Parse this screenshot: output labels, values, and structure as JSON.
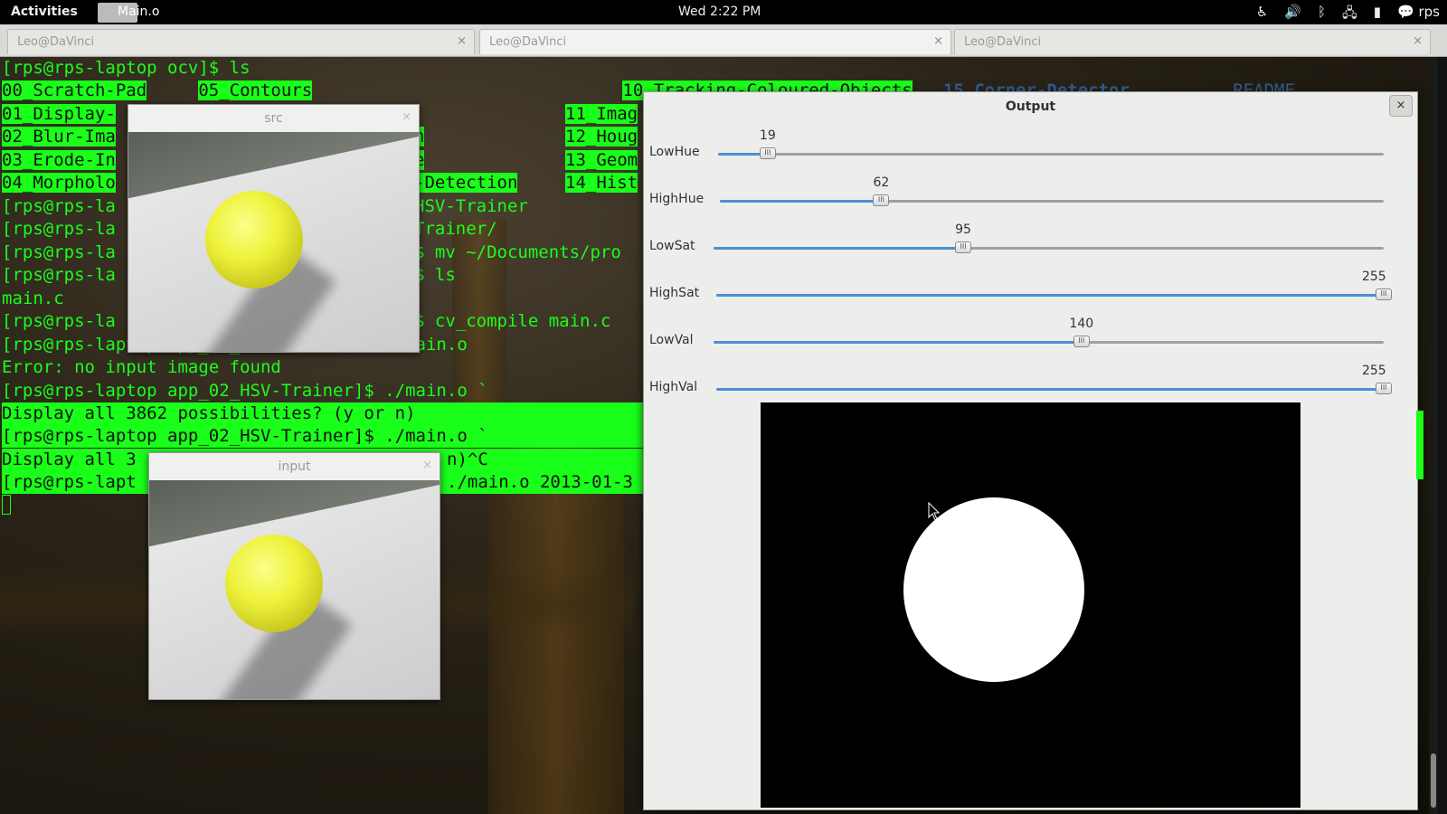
{
  "topbar": {
    "activities": "Activities",
    "app_name": "Main.o",
    "clock": "Wed  2:22 PM",
    "user": "rps",
    "icons": [
      "accessibility-icon",
      "volume-icon",
      "bluetooth-icon",
      "network-icon",
      "battery-icon",
      "chat-icon"
    ]
  },
  "tabs": [
    {
      "label": "Leo@DaVinci",
      "close": "×"
    },
    {
      "label": "Leo@DaVinci",
      "close": "×"
    },
    {
      "label": "Leo@DaVinci",
      "close": "×"
    }
  ],
  "terminal": {
    "lines": [
      "[rps@rps-laptop ocv]$ ls",
      "00_Scratch-Pad     05_Contours                              10_Tracking-Coloured-Objects   15_Corner-Detector          README",
      "01_Display-",
      "02_Blur-Ima",
      "03_Erode-In",
      "04_Morpholo",
      "[rps@rps-la",
      "[rps@rps-la",
      "[rps@rps-la",
      "[rps@rps-la",
      "main.c",
      "[rps@rps-la",
      "[rps@rps-laptop app_02_HSV-Trainer]$ ./main.o",
      "Error: no input image found",
      "[rps@rps-laptop app_02_HSV-Trainer]$ ./main.o `",
      "Display all 3862 possibilities? (y or n)",
      "[rps@rps-laptop app_02_HSV-Trainer]$ ./main.o `",
      "Display all 3",
      "[rps@rps-lapt"
    ],
    "mid_fragments": {
      "l7": "HSV-Trainer",
      "l8": "Trainer/",
      "l9": "$ mv ~/Documents/pro",
      "l10": "$ ls",
      "l12": "$ cv_compile main.c",
      "l18": "n)^C",
      "l19": "./main.o 2013-01-3",
      "l3b": "n",
      "l5b": "e",
      "l6b": "-Detection",
      "c11": "11_Imag",
      "c12": "12_Houg",
      "c13": "13_Geom",
      "c14": "14_Hist"
    }
  },
  "windows": {
    "src": {
      "title": "src",
      "close": "×"
    },
    "input": {
      "title": "input",
      "close": "×"
    }
  },
  "output": {
    "title": "Output",
    "close": "×",
    "sliders": [
      {
        "name": "LowHue",
        "value": "19",
        "fraction": 0.0745
      },
      {
        "name": "HighHue",
        "value": "62",
        "fraction": 0.2431
      },
      {
        "name": "LowSat",
        "value": "95",
        "fraction": 0.3725
      },
      {
        "name": "HighSat",
        "value": "255",
        "fraction": 1.0
      },
      {
        "name": "LowVal",
        "value": "140",
        "fraction": 0.549
      },
      {
        "name": "HighVal",
        "value": "255",
        "fraction": 1.0
      }
    ]
  }
}
